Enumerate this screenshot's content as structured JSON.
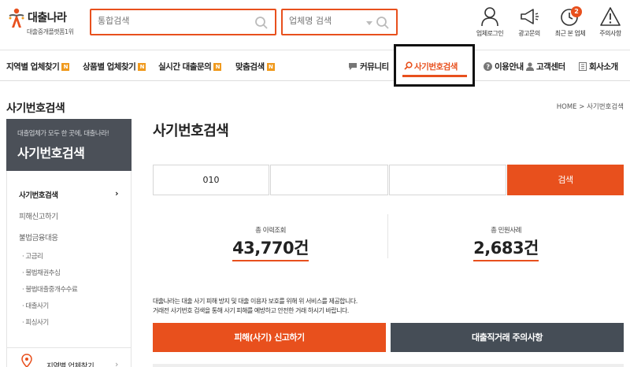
{
  "header": {
    "logo_name": "대출나라",
    "logo_sub": "대출중개플랫폼1위",
    "search_placeholder": "통합검색",
    "company_search_placeholder": "업체명 검색",
    "utils": [
      {
        "label": "업체로그인",
        "icon": "user-icon"
      },
      {
        "label": "광고문의",
        "icon": "megaphone-icon"
      },
      {
        "label": "최근 본 업체",
        "icon": "clock-icon",
        "badge": "2"
      },
      {
        "label": "주의사항",
        "icon": "warning-icon"
      }
    ]
  },
  "nav": {
    "items": [
      {
        "label": "지역별 업체찾기",
        "badge": "N"
      },
      {
        "label": "상품별 업체찾기",
        "badge": "N"
      },
      {
        "label": "실시간 대출문의",
        "badge": "N"
      },
      {
        "label": "맞춤검색",
        "badge": "N"
      }
    ],
    "right": [
      {
        "label": "커뮤니티",
        "icon": "chat-icon"
      },
      {
        "label": "사기번호검색",
        "icon": "search-icon",
        "active": true
      },
      {
        "label": "이용안내",
        "icon": "question-icon"
      },
      {
        "label": "고객센터",
        "icon": "person-icon"
      },
      {
        "label": "회사소개",
        "icon": "building-icon"
      }
    ]
  },
  "sidebar": {
    "title": "사기번호검색",
    "banner_sub": "대출업체가 모두 한 곳에, 대출나라!",
    "banner_title": "사기번호검색",
    "menu": [
      {
        "label": "사기번호검색",
        "active": true
      },
      {
        "label": "피해신고하기"
      },
      {
        "label": "불법금융대응"
      }
    ],
    "submenu": [
      "· 고금리",
      "· 불법채권추심",
      "· 불법대출중개수수료",
      "· 대출사기",
      "· 피싱사기"
    ],
    "footer_label": "지역별 업체찾기"
  },
  "main": {
    "breadcrumb": "HOME > 사기번호검색",
    "title": "사기번호검색",
    "phone": {
      "part1": "010",
      "part2": "",
      "part3": ""
    },
    "search_label": "검색",
    "stats": [
      {
        "label": "총 이력조회",
        "value": "43,770건"
      },
      {
        "label": "총 민원사례",
        "value": "2,683건"
      }
    ],
    "notice_line1": "대출나라는 대출 사기 피해 방지 및 대출 이용자 보호를 위해 위 서비스를 제공합니다.",
    "notice_line2": "거래전 사기번호 검색을 통해 사기 피해를 예방하고 안전한 거래 하시기 바랍니다.",
    "report_button": "피해(사기) 신고하기",
    "caution_button": "대출직거래 주의사항"
  },
  "colors": {
    "accent": "#e8501d",
    "dark": "#454d56",
    "banner": "#4b5058",
    "badge": "#f09a1e"
  }
}
